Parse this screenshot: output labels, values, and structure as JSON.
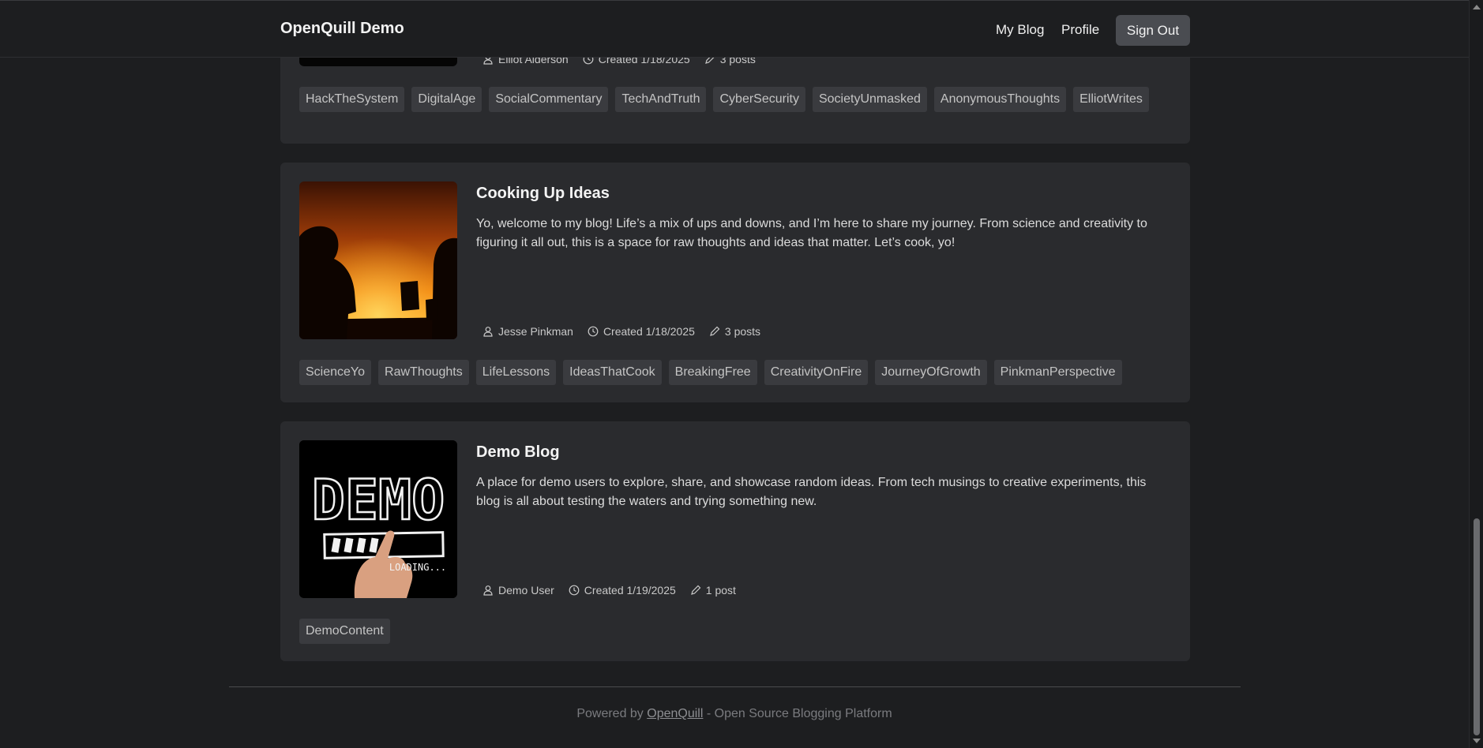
{
  "header": {
    "brand": "OpenQuill Demo",
    "nav": {
      "my_blog": "My Blog",
      "profile": "Profile"
    },
    "sign_out": "Sign Out"
  },
  "blogs": [
    {
      "title": "",
      "description": "",
      "author": "Elliot Alderson",
      "created": "Created 1/18/2025",
      "posts": "3 posts",
      "tags": [
        "HackTheSystem",
        "DigitalAge",
        "SocialCommentary",
        "TechAndTruth",
        "CyberSecurity",
        "SocietyUnmasked",
        "AnonymousThoughts",
        "ElliotWrites"
      ]
    },
    {
      "title": "Cooking Up Ideas",
      "description": "Yo, welcome to my blog! Life’s a mix of ups and downs, and I’m here to share my journey. From science and creativity to figuring it all out, this is a space for raw thoughts and ideas that matter. Let’s cook, yo!",
      "author": "Jesse Pinkman",
      "created": "Created 1/18/2025",
      "posts": "3 posts",
      "tags": [
        "ScienceYo",
        "RawThoughts",
        "LifeLessons",
        "IdeasThatCook",
        "BreakingFree",
        "CreativityOnFire",
        "JourneyOfGrowth",
        "PinkmanPerspective"
      ]
    },
    {
      "title": "Demo Blog",
      "description": "A place for demo users to explore, share, and showcase random ideas. From tech musings to creative experiments, this blog is all about testing the waters and trying something new.",
      "author": "Demo User",
      "created": "Created 1/19/2025",
      "posts": "1 post",
      "tags": [
        "DemoContent"
      ],
      "image_text": {
        "word": "DEMO",
        "loading": "LOADING..."
      }
    }
  ],
  "footer": {
    "prefix": "Powered by",
    "link": "OpenQuill",
    "suffix": "- Open Source Blogging Platform"
  },
  "colors": {
    "background": "#1d1e20",
    "card": "#2a2b2e",
    "tag": "#3a3b3f",
    "button": "#4a4c51"
  }
}
